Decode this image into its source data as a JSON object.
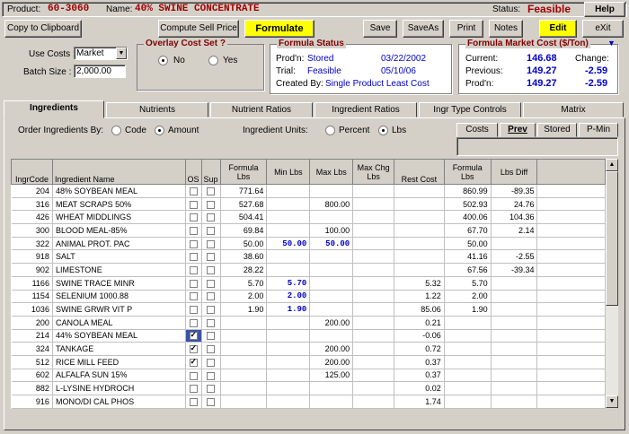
{
  "header": {
    "product_label": "Product:",
    "product_code": "60-3060",
    "name_label": "Name:",
    "product_name": "40% SWINE CONCENTRATE",
    "status_label": "Status:",
    "status_value": "Feasible",
    "help_label": "Help"
  },
  "toolbar": {
    "copy": "Copy to Clipboard",
    "compute": "Compute Sell Price",
    "formulate": "Formulate",
    "save": "Save",
    "saveas": "SaveAs",
    "print": "Print",
    "notes": "Notes",
    "edit": "Edit",
    "exit": "eXit"
  },
  "costs": {
    "use_costs_label": "Use Costs :",
    "use_costs_value": "Market",
    "batch_size_label": "Batch Size :",
    "batch_size_value": "2,000.00"
  },
  "overlay": {
    "title": "Overlay Cost Set ?",
    "no": "No",
    "yes": "Yes"
  },
  "formula_status": {
    "title": "Formula Status",
    "prodn_label": "Prod'n:",
    "prodn_value": "Stored",
    "prodn_date": "03/22/2002",
    "trial_label": "Trial:",
    "trial_value": "Feasible",
    "trial_date": "05/10/06",
    "created_label": "Created By:",
    "created_value": "Single Product Least Cost"
  },
  "market_cost": {
    "title": "Formula Market Cost ($/Ton)",
    "current_label": "Current:",
    "current_value": "146.68",
    "change_label": "Change:",
    "previous_label": "Previous:",
    "previous_value": "149.27",
    "previous_change": "-2.59",
    "prodn_label": "Prod'n:",
    "prodn_value": "149.27",
    "prodn_change": "-2.59"
  },
  "tabs": [
    "Ingredients",
    "Nutrients",
    "Nutrient Ratios",
    "Ingredient Ratios",
    "Ingr Type Controls",
    "Matrix"
  ],
  "order": {
    "label": "Order Ingredients By:",
    "code": "Code",
    "amount": "Amount",
    "units_label": "Ingredient Units:",
    "percent": "Percent",
    "lbs": "Lbs"
  },
  "subtabs": [
    "Costs",
    "Prev",
    "Stored",
    "P-Min"
  ],
  "columns": [
    "IngrCode",
    "Ingredient Name",
    "OS",
    "Sup",
    "Formula Lbs",
    "Min Lbs",
    "Max Lbs",
    "Max Chg Lbs",
    "Rest Cost",
    "Formula Lbs",
    "Lbs Diff"
  ],
  "rows": [
    {
      "code": "204",
      "name": "48% SOYBEAN MEAL",
      "os": false,
      "sup": false,
      "flbs": "771.64",
      "min": "",
      "max": "",
      "maxchg": "",
      "rest": "",
      "pflbs": "860.99",
      "diff": "-89.35"
    },
    {
      "code": "316",
      "name": "MEAT SCRAPS 50%",
      "os": false,
      "sup": false,
      "flbs": "527.68",
      "min": "",
      "max": "800.00",
      "maxchg": "",
      "rest": "",
      "pflbs": "502.93",
      "diff": "24.76"
    },
    {
      "code": "426",
      "name": "WHEAT MIDDLINGS",
      "os": false,
      "sup": false,
      "flbs": "504.41",
      "min": "",
      "max": "",
      "maxchg": "",
      "rest": "",
      "pflbs": "400.06",
      "diff": "104.36"
    },
    {
      "code": "300",
      "name": "BLOOD MEAL-85%",
      "os": false,
      "sup": false,
      "flbs": "69.84",
      "min": "",
      "max": "100.00",
      "maxchg": "",
      "rest": "",
      "pflbs": "67.70",
      "diff": "2.14"
    },
    {
      "code": "322",
      "name": "ANIMAL PROT. PAC",
      "os": false,
      "sup": false,
      "flbs": "50.00",
      "min": "50.00",
      "max": "50.00",
      "maxchg": "",
      "rest": "",
      "pflbs": "50.00",
      "diff": ""
    },
    {
      "code": "918",
      "name": "SALT",
      "os": false,
      "sup": false,
      "flbs": "38.60",
      "min": "",
      "max": "",
      "maxchg": "",
      "rest": "",
      "pflbs": "41.16",
      "diff": "-2.55"
    },
    {
      "code": "902",
      "name": "LIMESTONE",
      "os": false,
      "sup": false,
      "flbs": "28.22",
      "min": "",
      "max": "",
      "maxchg": "",
      "rest": "",
      "pflbs": "67.56",
      "diff": "-39.34"
    },
    {
      "code": "1166",
      "name": "SWINE TRACE MINR",
      "os": false,
      "sup": false,
      "flbs": "5.70",
      "min": "5.70",
      "max": "",
      "maxchg": "",
      "rest": "5.32",
      "pflbs": "5.70",
      "diff": ""
    },
    {
      "code": "1154",
      "name": "SELENIUM 1000.88",
      "os": false,
      "sup": false,
      "flbs": "2.00",
      "min": "2.00",
      "max": "",
      "maxchg": "",
      "rest": "1.22",
      "pflbs": "2.00",
      "diff": ""
    },
    {
      "code": "1036",
      "name": "SWINE GRWR VIT P",
      "os": false,
      "sup": false,
      "flbs": "1.90",
      "min": "1.90",
      "max": "",
      "maxchg": "",
      "rest": "85.06",
      "pflbs": "1.90",
      "diff": ""
    },
    {
      "code": "200",
      "name": "CANOLA MEAL",
      "os": false,
      "sup": false,
      "flbs": "",
      "min": "",
      "max": "200.00",
      "maxchg": "",
      "rest": "0.21",
      "pflbs": "",
      "diff": ""
    },
    {
      "code": "214",
      "name": "44% SOYBEAN MEAL",
      "os": true,
      "sup": false,
      "flbs": "",
      "min": "",
      "max": "",
      "maxchg": "",
      "rest": "-0.06",
      "pflbs": "",
      "diff": ""
    },
    {
      "code": "324",
      "name": "TANKAGE",
      "os": true,
      "sup": false,
      "flbs": "",
      "min": "",
      "max": "200.00",
      "maxchg": "",
      "rest": "0.72",
      "pflbs": "",
      "diff": ""
    },
    {
      "code": "512",
      "name": "RICE MILL FEED",
      "os": true,
      "sup": false,
      "flbs": "",
      "min": "",
      "max": "200.00",
      "maxchg": "",
      "rest": "0.37",
      "pflbs": "",
      "diff": ""
    },
    {
      "code": "602",
      "name": "ALFALFA SUN 15%",
      "os": false,
      "sup": false,
      "flbs": "",
      "min": "",
      "max": "125.00",
      "maxchg": "",
      "rest": "0.37",
      "pflbs": "",
      "diff": ""
    },
    {
      "code": "882",
      "name": "L-LYSINE HYDROCH",
      "os": false,
      "sup": false,
      "flbs": "",
      "min": "",
      "max": "",
      "maxchg": "",
      "rest": "0.02",
      "pflbs": "",
      "diff": ""
    },
    {
      "code": "916",
      "name": "MONO/DI CAL PHOS",
      "os": false,
      "sup": false,
      "flbs": "",
      "min": "",
      "max": "",
      "maxchg": "",
      "rest": "1.74",
      "pflbs": "",
      "diff": ""
    }
  ],
  "colors": {
    "title_red": "#a00000",
    "blue_value": "#0000cc",
    "yellow": "#ffff00",
    "group_title": "#800000"
  }
}
